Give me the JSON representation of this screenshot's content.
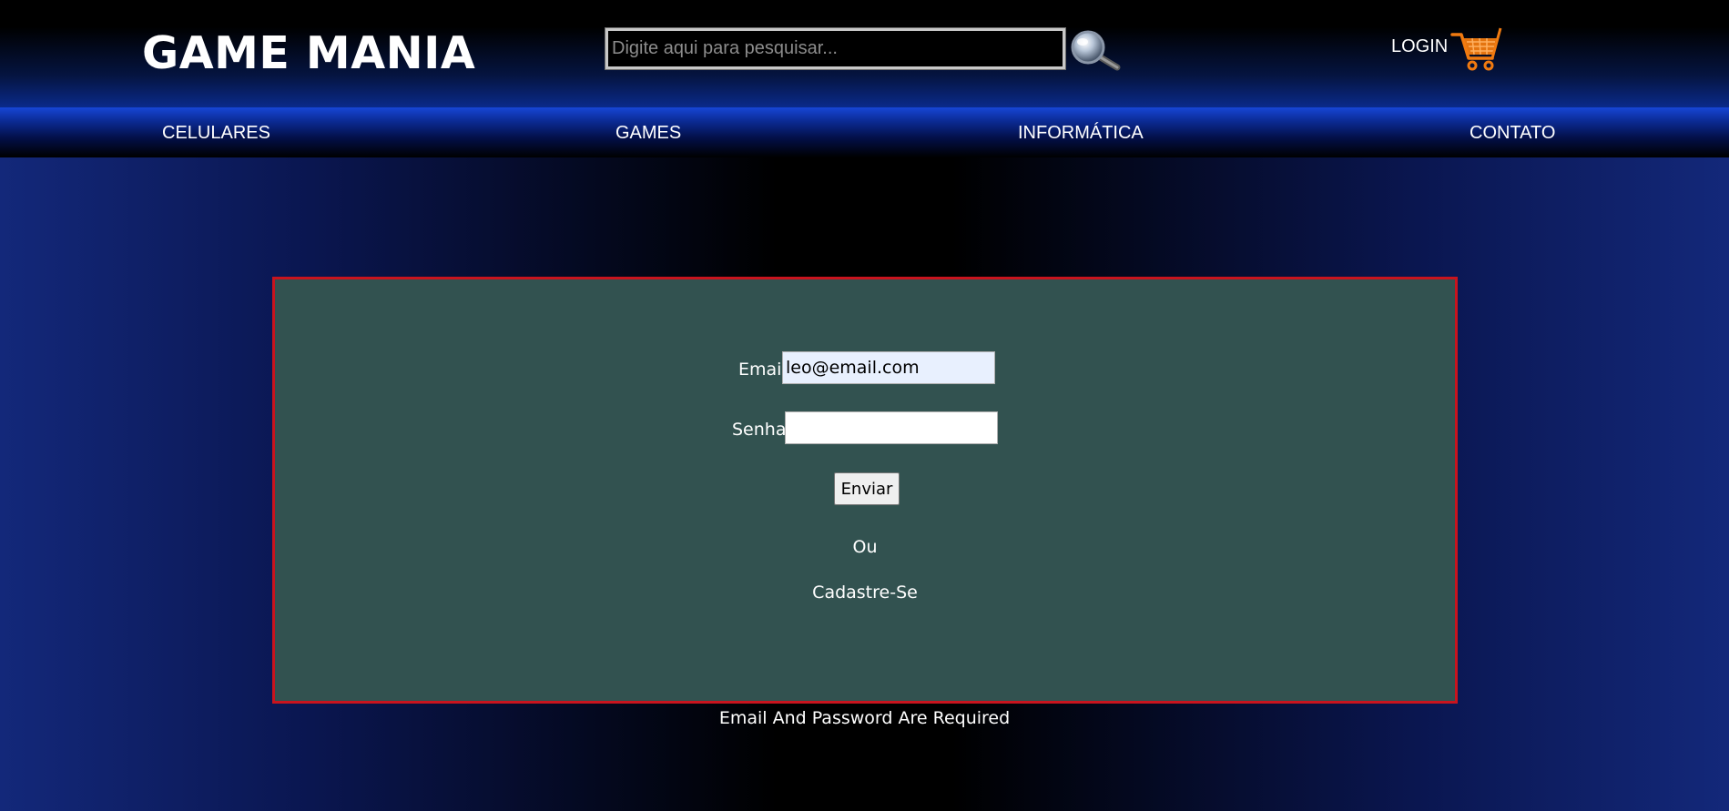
{
  "header": {
    "logo": "GAME MANIA",
    "search": {
      "placeholder": "Digite aqui para pesquisar...",
      "value": ""
    },
    "search_icon": "magnifier-icon",
    "login_label": "LOGIN",
    "cart_icon": "shopping-cart-icon"
  },
  "nav": {
    "items": [
      {
        "label": "CELULARES"
      },
      {
        "label": "GAMES"
      },
      {
        "label": "INFORMÁTICA"
      },
      {
        "label": "CONTATO"
      }
    ]
  },
  "login_form": {
    "email_label": "Email",
    "email_value": "leo@email.com",
    "password_label": "Senha",
    "password_value": "",
    "submit_label": "Enviar",
    "or_text": "Ou",
    "signup_label": "Cadastre-Se"
  },
  "error_message": "Email And Password Are Required",
  "colors": {
    "form_background": "#325250",
    "form_border": "#c8141e",
    "nav_blue": "#1746d6",
    "cart_orange": "#f07a10"
  }
}
